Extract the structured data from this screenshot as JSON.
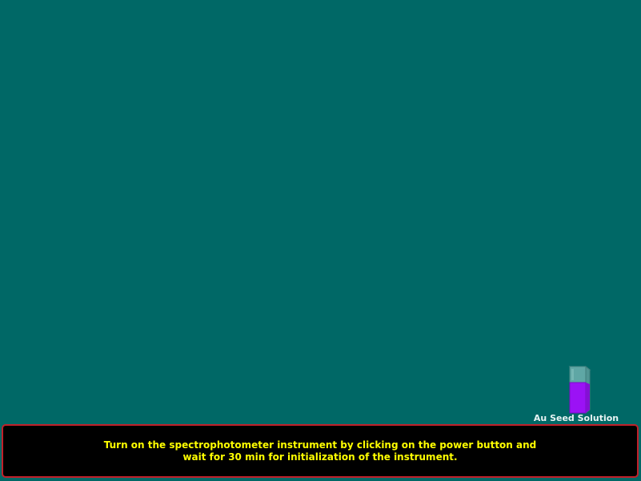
{
  "colors": {
    "background": "#006866",
    "panel_background": "#000000",
    "panel_border": "#c0202a",
    "instruction_text": "#ffff00",
    "label_text": "#e8f4f4",
    "solution": "#9b12f5",
    "cuvette_glass": "#5fa7a5"
  },
  "cuvette": {
    "icon": "cuvette-icon",
    "label": "Au Seed Solution"
  },
  "instruction": {
    "line1": "Turn on the spectrophotometer instrument by clicking on the power button and",
    "line2": "wait for 30 min for initialization of the instrument."
  }
}
